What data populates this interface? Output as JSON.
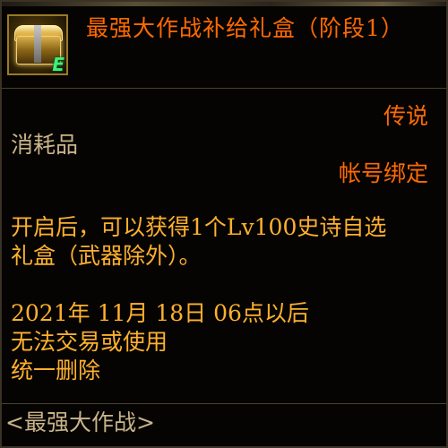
{
  "item": {
    "name": "最强大作战补给礼盒（阶段1）",
    "icon": "golden-treasure-chest-icon",
    "icon_badge": "E",
    "grade": "传说",
    "category": "消耗品",
    "binding": "帐号绑定",
    "description_lines": [
      "开启后，可以获得1个Lv100史诗自选",
      "礼盒（武器除外）。"
    ],
    "expiry_lines": [
      "2021年 11月 18日 06点以后",
      "无法交易或使用",
      "统一删除"
    ],
    "series": "<最强大作战>"
  },
  "colors": {
    "title": "#ff6a00",
    "grade": "#ff6a00",
    "binding": "#ff6a00",
    "body_text": "#ffb02e",
    "secondary_text": "#c9b48a",
    "background": "#050403",
    "badge": "#3ff07a"
  }
}
